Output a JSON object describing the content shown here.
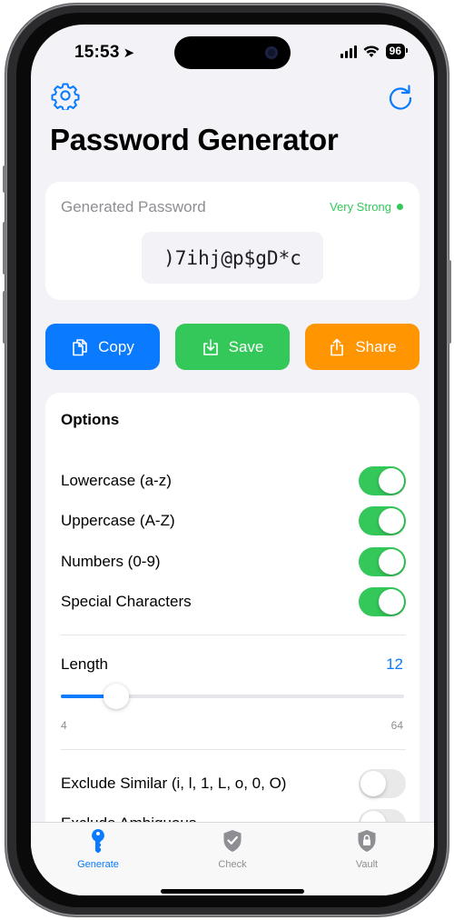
{
  "status_bar": {
    "time": "15:53",
    "battery": "96"
  },
  "header": {
    "title": "Password Generator"
  },
  "password_card": {
    "label": "Generated Password",
    "strength": "Very Strong",
    "password": ")7ihj@p$gD*c"
  },
  "actions": {
    "copy_label": "Copy",
    "save_label": "Save",
    "share_label": "Share"
  },
  "options": {
    "title": "Options",
    "lowercase": {
      "label": "Lowercase (a-z)",
      "enabled": true
    },
    "uppercase": {
      "label": "Uppercase (A-Z)",
      "enabled": true
    },
    "numbers": {
      "label": "Numbers (0-9)",
      "enabled": true
    },
    "special": {
      "label": "Special Characters",
      "enabled": true
    },
    "length": {
      "label": "Length",
      "value": "12",
      "min": "4",
      "max": "64"
    },
    "exclude_similar": {
      "label": "Exclude Similar (i, l, 1, L, o, 0, O)",
      "enabled": false
    },
    "exclude_ambiguous": {
      "label": "Exclude Ambiguous",
      "enabled": false
    }
  },
  "tabbar": {
    "generate": "Generate",
    "check": "Check",
    "vault": "Vault"
  },
  "colors": {
    "accent": "#0a7aff",
    "success": "#34c759",
    "warning": "#ff9500",
    "background": "#f2f2f7"
  },
  "icons": {
    "settings": "gear-icon",
    "refresh": "refresh-icon",
    "copy": "copy-icon",
    "save": "download-icon",
    "share": "share-icon",
    "generate": "key-icon",
    "check": "shield-check-icon",
    "vault": "lock-shield-icon"
  }
}
